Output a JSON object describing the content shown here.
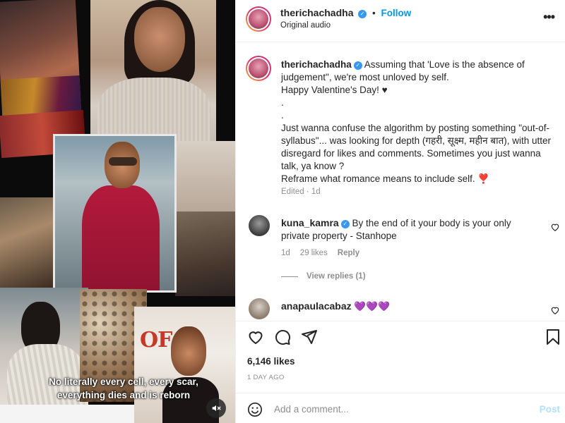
{
  "media": {
    "caption_line1": "No literally every cell, every scar,",
    "caption_line2": "everything dies and is reborn",
    "poster_text": "OF Q",
    "mute_icon": "speaker-muted-icon"
  },
  "post": {
    "username": "therichachadha",
    "follow_label": "Follow",
    "audio_label": "Original audio",
    "caption": {
      "username": "therichachadha",
      "text": " Assuming that 'Love is the absence of judgement\", we're most unloved by self.\nHappy Valentine's Day! ♥\n.\n.\nJust wanna confuse the algorithm by posting something \"out-of-syllabus\"... was looking for depth (गहरी, सूक्ष्म, महीन बात), with utter disregard for likes and comments. Sometimes you just wanna talk, ya know ?\nReframe what romance means to include self. ❣️",
      "meta": "Edited · 1d"
    },
    "comments": [
      {
        "username": "kuna_kamra",
        "text": " By the end of it your body is your only private property - Stanhope",
        "age": "1d",
        "likes": "29 likes",
        "reply_label": "Reply",
        "view_replies": "View replies (1)"
      },
      {
        "username": "anapaulacabaz",
        "text": " 💜💜💜"
      }
    ],
    "likes": "6,146 likes",
    "date": "1 DAY AGO",
    "comment_placeholder": "Add a comment...",
    "post_label": "Post"
  },
  "colors": {
    "link_blue": "#0095f6",
    "verified_blue": "#3897f0",
    "post_disabled": "#b2dffc",
    "muted_text": "#8e8e8e",
    "heart_red": "#c0182a"
  },
  "icons": [
    "heart-icon",
    "comment-icon",
    "share-icon",
    "bookmark-icon",
    "emoji-icon",
    "more-options-icon",
    "verified-badge-icon"
  ]
}
